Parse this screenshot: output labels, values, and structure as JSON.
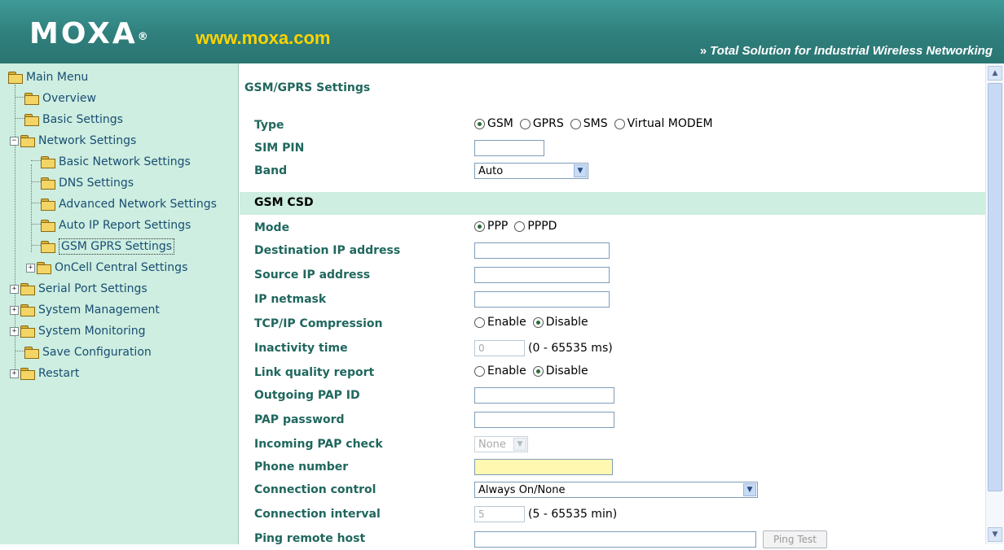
{
  "header": {
    "logo": "MOXA",
    "logo_mark": "®",
    "url": "www.moxa.com",
    "tagline_arrow": "»",
    "tagline": "Total Solution for Industrial Wireless Networking"
  },
  "sidebar": {
    "items": [
      {
        "label": "Main Menu"
      },
      {
        "label": "Overview"
      },
      {
        "label": "Basic Settings"
      },
      {
        "label": "Network Settings"
      },
      {
        "label": "Basic Network Settings"
      },
      {
        "label": "DNS Settings"
      },
      {
        "label": "Advanced Network Settings"
      },
      {
        "label": "Auto IP Report Settings"
      },
      {
        "label": "GSM GPRS Settings"
      },
      {
        "label": "OnCell Central Settings"
      },
      {
        "label": "Serial Port Settings"
      },
      {
        "label": "System Management"
      },
      {
        "label": "System Monitoring"
      },
      {
        "label": "Save Configuration"
      },
      {
        "label": "Restart"
      }
    ]
  },
  "main": {
    "title": "GSM/GPRS Settings",
    "type": {
      "label": "Type",
      "options": [
        "GSM",
        "GPRS",
        "SMS",
        "Virtual MODEM"
      ],
      "selected": "GSM"
    },
    "sim_pin": {
      "label": "SIM PIN",
      "value": ""
    },
    "band": {
      "label": "Band",
      "value": "Auto"
    },
    "section": "GSM CSD",
    "mode": {
      "label": "Mode",
      "options": [
        "PPP",
        "PPPD"
      ],
      "selected": "PPP"
    },
    "dest_ip": {
      "label": "Destination IP address",
      "value": ""
    },
    "source_ip": {
      "label": "Source IP address",
      "value": ""
    },
    "netmask": {
      "label": "IP netmask",
      "value": ""
    },
    "tcp_compression": {
      "label": "TCP/IP Compression",
      "options": [
        "Enable",
        "Disable"
      ],
      "selected": "Disable"
    },
    "inactivity": {
      "label": "Inactivity time",
      "value": "0",
      "suffix": "(0 - 65535 ms)"
    },
    "link_quality": {
      "label": "Link quality report",
      "options": [
        "Enable",
        "Disable"
      ],
      "selected": "Disable"
    },
    "pap_id": {
      "label": "Outgoing PAP ID",
      "value": ""
    },
    "pap_password": {
      "label": "PAP password",
      "value": ""
    },
    "pap_check": {
      "label": "Incoming PAP check",
      "value": "None"
    },
    "phone": {
      "label": "Phone number",
      "value": ""
    },
    "conn_control": {
      "label": "Connection control",
      "value": "Always On/None"
    },
    "conn_interval": {
      "label": "Connection interval",
      "value": "5",
      "suffix": "(5 - 65535 min)"
    },
    "ping_host": {
      "label": "Ping remote host",
      "value": "",
      "button": "Ping Test"
    }
  }
}
